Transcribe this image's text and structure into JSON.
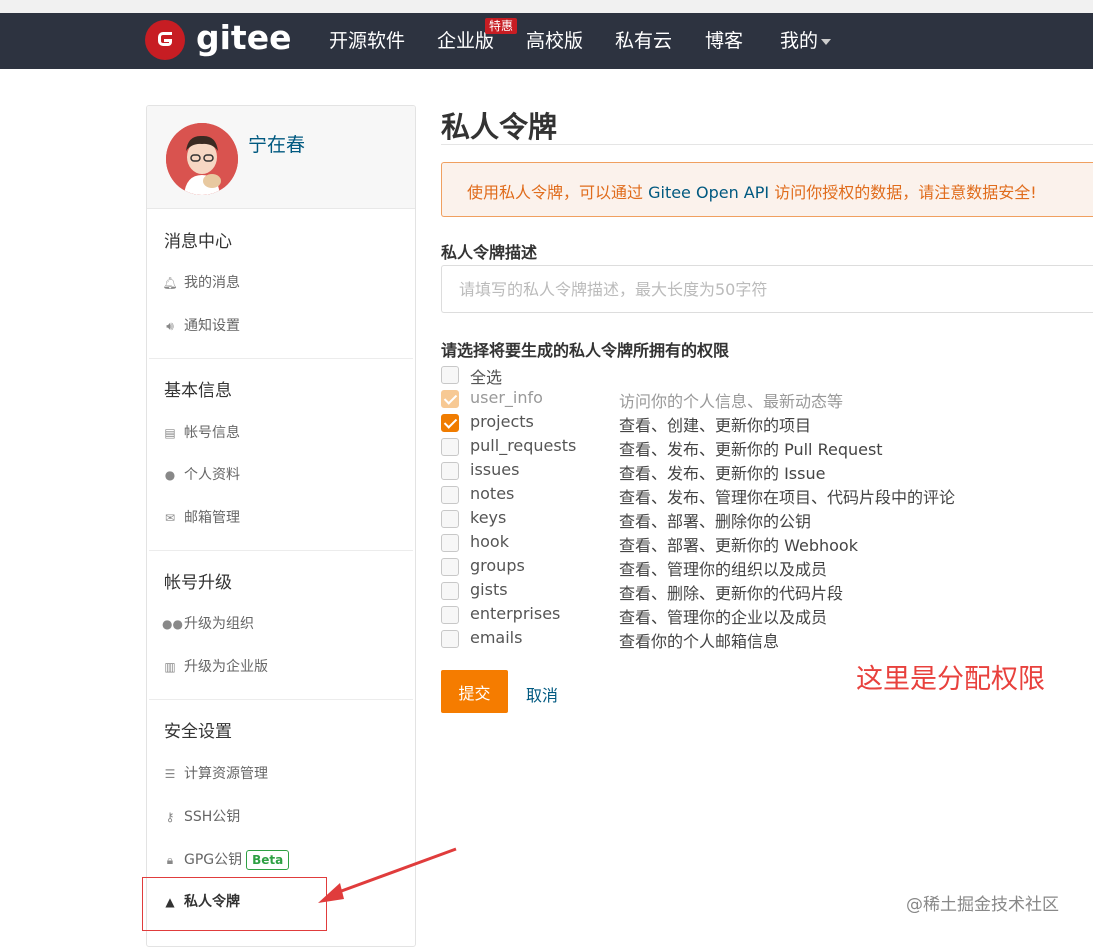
{
  "nav": {
    "brand": "gitee",
    "items": [
      "开源软件",
      "企业版",
      "高校版",
      "私有云",
      "博客",
      "我的"
    ],
    "badge": "特惠"
  },
  "sidebar": {
    "username": "宁在春",
    "sections": [
      {
        "title": "消息中心",
        "items": [
          "我的消息",
          "通知设置"
        ]
      },
      {
        "title": "基本信息",
        "items": [
          "帐号信息",
          "个人资料",
          "邮箱管理"
        ]
      },
      {
        "title": "帐号升级",
        "items": [
          "升级为组织",
          "升级为企业版"
        ]
      },
      {
        "title": "安全设置",
        "items": [
          "计算资源管理",
          "SSH公钥",
          "GPG公钥",
          "私人令牌"
        ]
      }
    ],
    "beta_label": "Beta"
  },
  "main": {
    "title": "私人令牌",
    "alert": {
      "before": "使用私人令牌，可以通过 ",
      "link": "Gitee Open API",
      "after": " 访问你授权的数据，请注意数据安全!"
    },
    "desc_label": "私人令牌描述",
    "desc_placeholder": "请填写的私人令牌描述，最大长度为50字符",
    "perm_label": "请选择将要生成的私人令牌所拥有的权限",
    "select_all": "全选",
    "permissions": [
      {
        "name": "user_info",
        "desc": "访问你的个人信息、最新动态等",
        "checked": true,
        "disabled": true
      },
      {
        "name": "projects",
        "desc": "查看、创建、更新你的项目",
        "checked": true,
        "disabled": false
      },
      {
        "name": "pull_requests",
        "desc": "查看、发布、更新你的 Pull Request",
        "checked": false,
        "disabled": false
      },
      {
        "name": "issues",
        "desc": "查看、发布、更新你的 Issue",
        "checked": false,
        "disabled": false
      },
      {
        "name": "notes",
        "desc": "查看、发布、管理你在项目、代码片段中的评论",
        "checked": false,
        "disabled": false
      },
      {
        "name": "keys",
        "desc": "查看、部署、删除你的公钥",
        "checked": false,
        "disabled": false
      },
      {
        "name": "hook",
        "desc": "查看、部署、更新你的 Webhook",
        "checked": false,
        "disabled": false
      },
      {
        "name": "groups",
        "desc": "查看、管理你的组织以及成员",
        "checked": false,
        "disabled": false
      },
      {
        "name": "gists",
        "desc": "查看、删除、更新你的代码片段",
        "checked": false,
        "disabled": false
      },
      {
        "name": "enterprises",
        "desc": "查看、管理你的企业以及成员",
        "checked": false,
        "disabled": false
      },
      {
        "name": "emails",
        "desc": "查看你的个人邮箱信息",
        "checked": false,
        "disabled": false
      }
    ],
    "submit": "提交",
    "cancel": "取消"
  },
  "annotation": "这里是分配权限",
  "watermark": "@稀土掘金技术社区",
  "colors": {
    "nav_bg": "#2d3340",
    "brand_red": "#c71d23",
    "accent_orange": "#f57c00",
    "link_blue": "#005980"
  }
}
